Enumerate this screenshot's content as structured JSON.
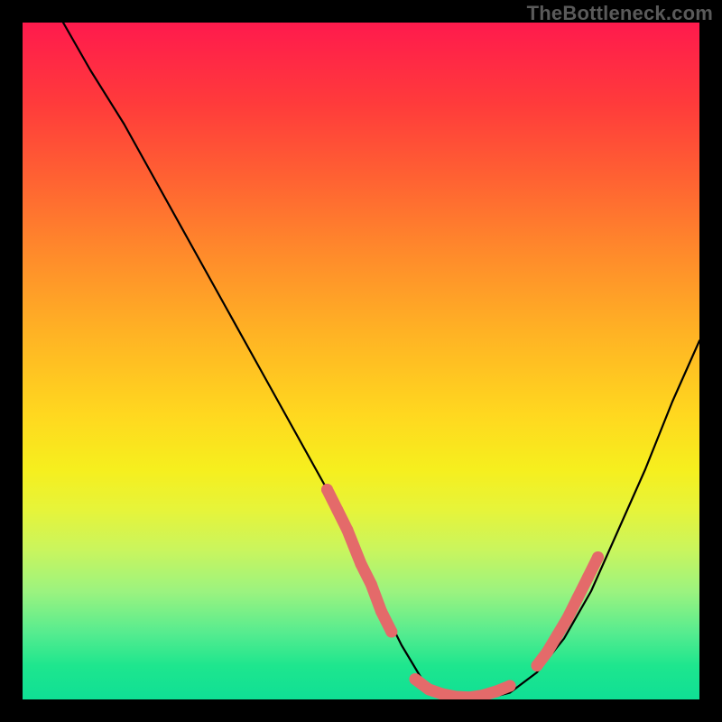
{
  "watermark": "TheBottleneck.com",
  "chart_data": {
    "type": "line",
    "title": "",
    "xlabel": "",
    "ylabel": "",
    "xlim": [
      0,
      100
    ],
    "ylim": [
      0,
      100
    ],
    "grid": false,
    "legend": false,
    "series": [
      {
        "name": "bottleneck-curve",
        "color": "#000000",
        "x": [
          6,
          10,
          15,
          20,
          25,
          30,
          35,
          40,
          45,
          50,
          53,
          56,
          59,
          62,
          65,
          68,
          72,
          76,
          80,
          84,
          88,
          92,
          96,
          100
        ],
        "y": [
          100,
          93,
          85,
          76,
          67,
          58,
          49,
          40,
          31,
          21,
          14,
          8,
          3,
          1,
          0,
          0,
          1,
          4,
          9,
          16,
          25,
          34,
          44,
          53
        ]
      }
    ],
    "markers": [
      {
        "name": "valley-marker-left",
        "color": "#e46a6a",
        "shape": "capsule",
        "points": [
          {
            "x": 45,
            "y": 31
          },
          {
            "x": 46.5,
            "y": 28
          },
          {
            "x": 48,
            "y": 25
          },
          {
            "x": 50,
            "y": 20
          },
          {
            "x": 51.5,
            "y": 17
          },
          {
            "x": 53,
            "y": 13
          },
          {
            "x": 54.5,
            "y": 10
          }
        ]
      },
      {
        "name": "valley-marker-bottom",
        "color": "#e46a6a",
        "shape": "capsule",
        "points": [
          {
            "x": 58,
            "y": 3
          },
          {
            "x": 60,
            "y": 1.5
          },
          {
            "x": 62,
            "y": 0.8
          },
          {
            "x": 64,
            "y": 0.4
          },
          {
            "x": 66,
            "y": 0.3
          },
          {
            "x": 68,
            "y": 0.6
          },
          {
            "x": 70,
            "y": 1.2
          },
          {
            "x": 72,
            "y": 2
          }
        ]
      },
      {
        "name": "valley-marker-right",
        "color": "#e46a6a",
        "shape": "capsule",
        "points": [
          {
            "x": 76,
            "y": 5
          },
          {
            "x": 77.5,
            "y": 7
          },
          {
            "x": 79,
            "y": 9.5
          },
          {
            "x": 80.5,
            "y": 12
          },
          {
            "x": 82,
            "y": 15
          },
          {
            "x": 83.5,
            "y": 18
          },
          {
            "x": 85,
            "y": 21
          }
        ]
      }
    ],
    "background_gradient": {
      "top": "#ff1a4d",
      "mid": "#ffd81f",
      "bottom": "#0fdf95"
    }
  }
}
